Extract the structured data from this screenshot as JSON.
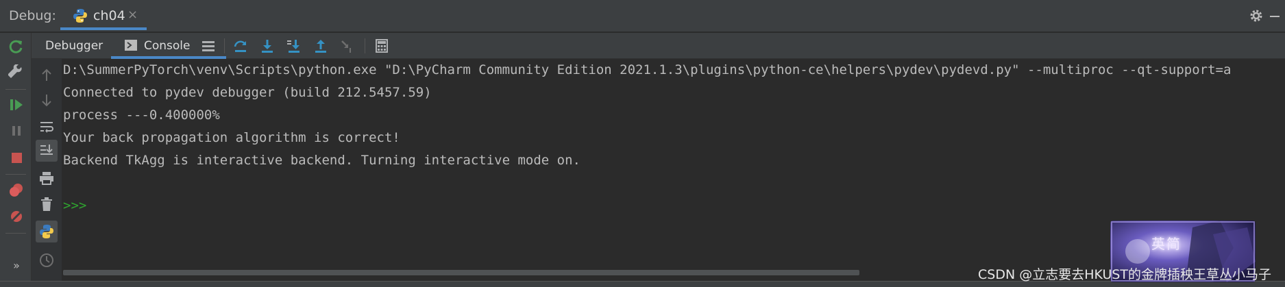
{
  "titlebar": {
    "debug_label": "Debug:",
    "tab_name": "ch04",
    "tab_close": "×",
    "accent": "#4a88c7"
  },
  "toolbar": {
    "debugger_tab": "Debugger",
    "console_tab": "Console"
  },
  "console": {
    "lines": [
      "D:\\SummerPyTorch\\venv\\Scripts\\python.exe \"D:\\PyCharm Community Edition 2021.1.3\\plugins\\python-ce\\helpers\\pydev\\pydevd.py\" --multiproc --qt-support=a",
      "Connected to pydev debugger (build 212.5457.59)",
      "process ---0.400000%",
      "Your back propagation algorithm is correct!",
      "Backend TkAgg is interactive backend. Turning interactive mode on."
    ],
    "prompt": ">>>",
    "prompt_color": "#2fa42f"
  },
  "leftbar": {
    "more": "»"
  },
  "ad": {
    "text": "英简"
  },
  "watermark": "CSDN @立志要去HKUST的金牌插秧王草丛小马子",
  "icons": [
    "python-icon",
    "gear-icon",
    "minimize-icon",
    "rerun-icon",
    "wrench-icon",
    "resume-icon",
    "pause-icon",
    "stop-icon",
    "view-breakpoints-icon",
    "mute-breakpoints-icon",
    "more-icon",
    "layout-icon",
    "step-over-icon",
    "step-into-icon",
    "step-into-my-code-icon",
    "step-out-icon",
    "run-to-cursor-icon",
    "evaluate-icon",
    "up-arrow-icon",
    "down-arrow-icon",
    "soft-wrap-icon",
    "scroll-to-end-icon",
    "print-icon",
    "clear-icon",
    "python-console-icon",
    "history-icon"
  ]
}
